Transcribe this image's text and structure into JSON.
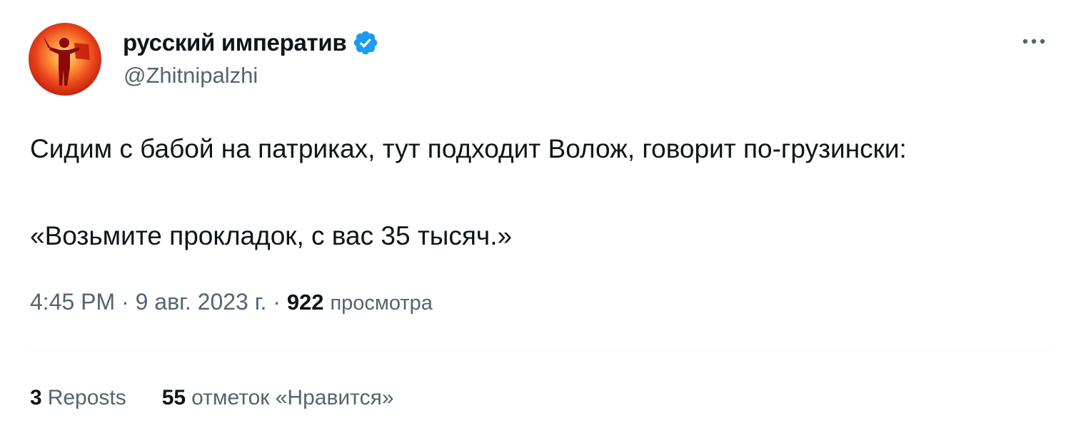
{
  "author": {
    "display_name": "русский императив",
    "handle": "@Zhitnipalzhi",
    "verified_color": "#1d9bf0"
  },
  "tweet": {
    "line1": "Сидим с бабой на патриках, тут подходит Волож, говорит по-грузински:",
    "line2": "«Возьмите прокладок, с вас 35 тысяч.»"
  },
  "meta": {
    "time": "4:45 PM",
    "separator": "·",
    "date": "9 авг. 2023 г.",
    "views_count": "922",
    "views_label": "просмотра"
  },
  "stats": {
    "reposts_count": "3",
    "reposts_label": "Reposts",
    "likes_count": "55",
    "likes_label": "отметок «Нравится»"
  },
  "icons": {
    "verified": "verified-badge-icon",
    "more": "more-horizontal-icon"
  }
}
